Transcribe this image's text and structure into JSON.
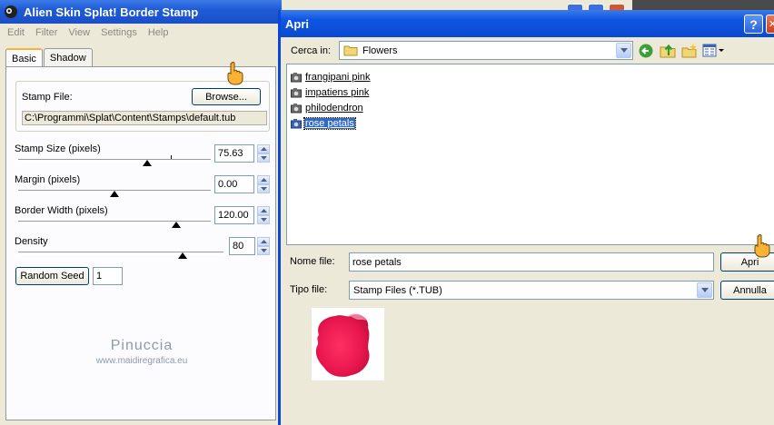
{
  "splat": {
    "title": "Alien Skin Splat! Border Stamp",
    "menu": [
      "Edit",
      "Filter",
      "View",
      "Settings",
      "Help"
    ],
    "tabs": [
      "Basic",
      "Shadow"
    ],
    "stamp_file_label": "Stamp File:",
    "browse_label": "Browse...",
    "stamp_path": "C:\\Programmi\\Splat\\Content\\Stamps\\default.tub",
    "stamp_size": {
      "label": "Stamp Size (pixels)",
      "value": "75.63",
      "fraction": 0.67
    },
    "margin": {
      "label": "Margin (pixels)",
      "value": "0.00",
      "fraction": 0.5
    },
    "border_width": {
      "label": "Border Width (pixels)",
      "value": "120.00",
      "fraction": 0.82
    },
    "density": {
      "label": "Density",
      "value": "80",
      "fraction": 0.8
    },
    "random_seed_label": "Random Seed",
    "random_seed_value": "1",
    "watermark_name": "Pinuccia",
    "watermark_site": "www.maidiregrafica.eu"
  },
  "dialog": {
    "title": "Apri",
    "look_in_label": "Cerca in:",
    "look_in_value": "Flowers",
    "files": [
      {
        "name": "frangipani pink",
        "selected": false
      },
      {
        "name": "impatiens pink",
        "selected": false
      },
      {
        "name": "philodendron",
        "selected": false
      },
      {
        "name": "rose petals",
        "selected": true
      }
    ],
    "filename_label": "Nome file:",
    "filename_value": "rose petals",
    "filetype_label": "Tipo file:",
    "filetype_value": "Stamp Files (*.TUB)",
    "open_label": "Apri",
    "cancel_label": "Annulla",
    "help_symbol": "?",
    "close_symbol": "✕"
  },
  "colors": {
    "titlebar": "#0a4ad2",
    "selection": "#316ac5",
    "petal": "#e8174e",
    "pointer": "#f9b233"
  }
}
